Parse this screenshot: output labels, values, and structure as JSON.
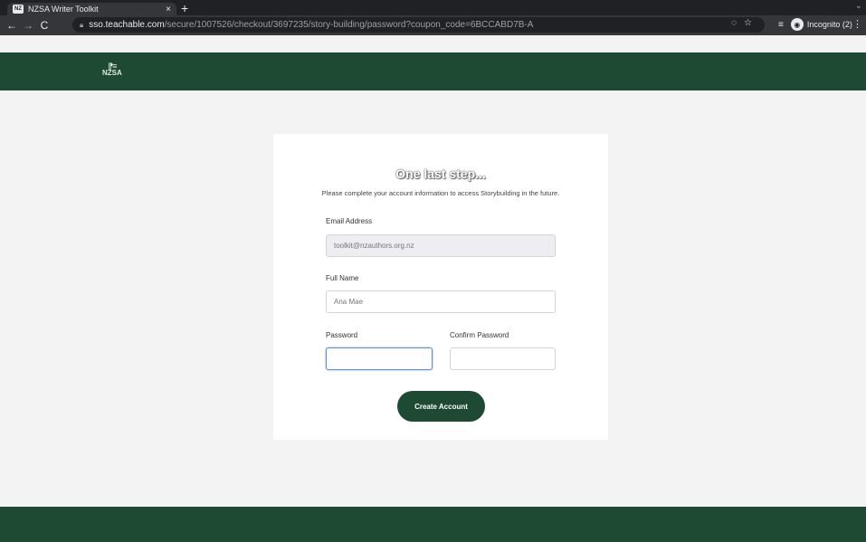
{
  "browser": {
    "tab_title": "NZSA Writer Toolkit",
    "tab_favicon_text": "NZ",
    "close_glyph": "×",
    "new_tab_glyph": "+",
    "tab_search_glyph": "⌄",
    "back_glyph": "←",
    "forward_glyph": "→",
    "reload_glyph": "C",
    "url_domain": "sso.teachable.com",
    "url_path": "/secure/1007526/checkout/3697235/story-building/password?coupon_code=6BCCABD7B-A",
    "incognito_label": "Incognito (2)",
    "menu_glyph": "⋮"
  },
  "site": {
    "logo_text": "NZSA"
  },
  "form": {
    "title": "One last step...",
    "subtitle": "Please complete your account information to access Storybuilding in the future.",
    "email_label": "Email Address",
    "email_value": "toolkit@nzauthors.org.nz",
    "fullname_label": "Full Name",
    "fullname_value": "Ana Mae",
    "password_label": "Password",
    "password_value": "",
    "confirm_label": "Confirm Password",
    "confirm_value": "",
    "submit_label": "Create Account"
  }
}
